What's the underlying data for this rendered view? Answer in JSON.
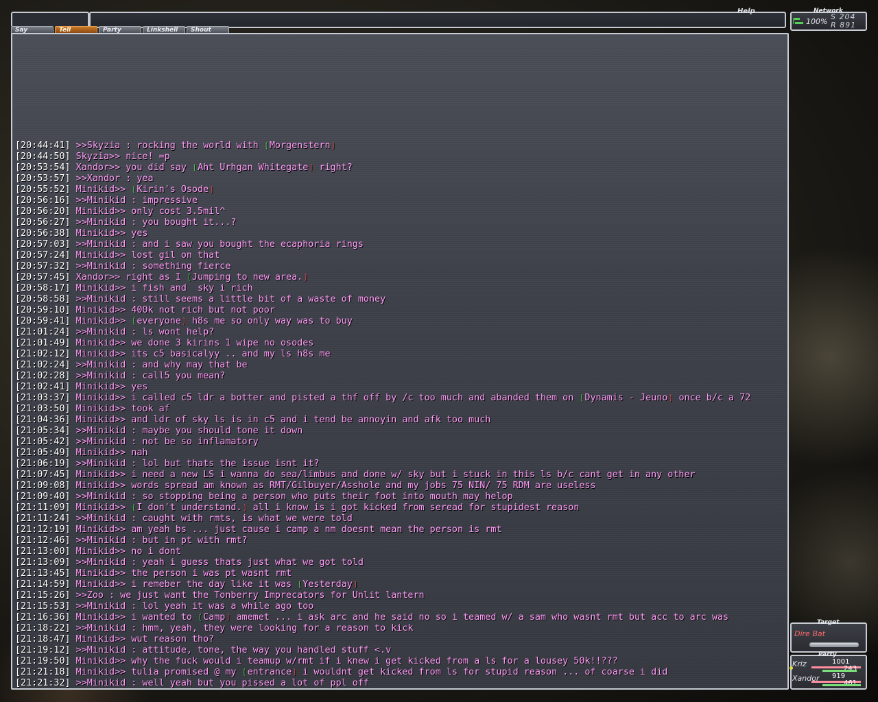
{
  "header": {
    "help_label": "Help",
    "tabs": [
      {
        "label": "Say"
      },
      {
        "label": "Tell"
      },
      {
        "label": "Party"
      },
      {
        "label": "Linkshell"
      },
      {
        "label": "Shout"
      }
    ],
    "active_tab": "Tell"
  },
  "network": {
    "label": "Network",
    "percent": "100%",
    "s_value": "S 204",
    "r_value": "R 891"
  },
  "target": {
    "label": "Target",
    "name": "Dire Bat",
    "hp_fraction": 1.0
  },
  "party": {
    "label": "Party",
    "members": [
      {
        "name": "Kriz",
        "hp": "1001",
        "mp": "243",
        "hp_fraction": 1.0,
        "mp_fraction": 0.9
      },
      {
        "name": "Xandor",
        "hp": "919",
        "mp": "461",
        "hp_fraction": 1.0,
        "mp_fraction": 1.0
      }
    ]
  },
  "colors": {
    "chat_text": "#ff9cf7",
    "autotranslate_open": "#4ee04a",
    "autotranslate_close": "#ff4b4b",
    "active_tab": "#c97a28"
  },
  "chat": [
    {
      "ts": "[20:44:41]",
      "pre": " >>Skyzia : rocking the world with ",
      "at": "Morgenstern",
      "post": ""
    },
    {
      "ts": "[20:44:50]",
      "pre": " Skyzia>> nice! =p",
      "at": "",
      "post": ""
    },
    {
      "ts": "[20:53:54]",
      "pre": " Xandor>> you did say ",
      "at": "Aht Urhgan Whitegate",
      "post": " right?"
    },
    {
      "ts": "[20:53:57]",
      "pre": " >>Xandor : yea",
      "at": "",
      "post": ""
    },
    {
      "ts": "[20:55:52]",
      "pre": " Minikid>> ",
      "at": "Kirin's Osode",
      "post": ""
    },
    {
      "ts": "[20:56:16]",
      "pre": " >>Minikid : impressive",
      "at": "",
      "post": ""
    },
    {
      "ts": "[20:56:20]",
      "pre": " Minikid>> only cost 3.5mil^",
      "at": "",
      "post": ""
    },
    {
      "ts": "[20:56:27]",
      "pre": " >>Minikid : you bought it...?",
      "at": "",
      "post": ""
    },
    {
      "ts": "[20:56:38]",
      "pre": " Minikid>> yes",
      "at": "",
      "post": ""
    },
    {
      "ts": "[20:57:03]",
      "pre": " >>Minikid : and i saw you bought the ecaphoria rings",
      "at": "",
      "post": ""
    },
    {
      "ts": "[20:57:24]",
      "pre": " Minikid>> lost gil on that",
      "at": "",
      "post": ""
    },
    {
      "ts": "[20:57:32]",
      "pre": " >>Minikid : something fierce",
      "at": "",
      "post": ""
    },
    {
      "ts": "[20:57:45]",
      "pre": " Xandor>> right as I ",
      "at": "Jumping to new area.",
      "post": ""
    },
    {
      "ts": "[20:58:17]",
      "pre": " Minikid>> i fish and  sky i rich",
      "at": "",
      "post": ""
    },
    {
      "ts": "[20:58:58]",
      "pre": " >>Minikid : still seems a little bit of a waste of money",
      "at": "",
      "post": ""
    },
    {
      "ts": "[20:59:10]",
      "pre": " Minikid>> 400k not rich but not poor",
      "at": "",
      "post": ""
    },
    {
      "ts": "[20:59:41]",
      "pre": " Minikid>> ",
      "at": "everyone",
      "post": " h8s me so only way was to buy"
    },
    {
      "ts": "[21:01:24]",
      "pre": " >>Minikid : ls wont help?",
      "at": "",
      "post": ""
    },
    {
      "ts": "[21:01:49]",
      "pre": " Minikid>> we done 3 kirins 1 wipe no osodes",
      "at": "",
      "post": ""
    },
    {
      "ts": "[21:02:12]",
      "pre": " Minikid>> its c5 basicalyy .. and my ls h8s me",
      "at": "",
      "post": ""
    },
    {
      "ts": "[21:02:24]",
      "pre": " >>Minikid : and why may that be",
      "at": "",
      "post": ""
    },
    {
      "ts": "[21:02:28]",
      "pre": " >>Minikid : call5 you mean?",
      "at": "",
      "post": ""
    },
    {
      "ts": "[21:02:41]",
      "pre": " Minikid>> yes",
      "at": "",
      "post": ""
    },
    {
      "ts": "[21:03:37]",
      "pre": " Minikid>> i called c5 ldr a botter and pisted a thf off by /c too much and abanded them on ",
      "at": "Dynamis - Jeuno",
      "post": " once b/c a 72"
    },
    {
      "ts": "[21:03:50]",
      "pre": " Minikid>> took af",
      "at": "",
      "post": ""
    },
    {
      "ts": "[21:04:36]",
      "pre": " Minikid>> and ldr of sky ls is in c5 and i tend be annoyin and afk too much",
      "at": "",
      "post": ""
    },
    {
      "ts": "[21:05:34]",
      "pre": " >>Minikid : maybe you should tone it down",
      "at": "",
      "post": ""
    },
    {
      "ts": "[21:05:42]",
      "pre": " >>Minikid : not be so inflamatory",
      "at": "",
      "post": ""
    },
    {
      "ts": "[21:05:49]",
      "pre": " Minikid>> nah",
      "at": "",
      "post": ""
    },
    {
      "ts": "[21:06:19]",
      "pre": " >>Minikid : lol but thats the issue isnt it?",
      "at": "",
      "post": ""
    },
    {
      "ts": "[21:07:45]",
      "pre": " Minikid>> i need a new LS i wanna do sea/limbus and done w/ sky but i stuck in this ls b/c cant get in any other",
      "at": "",
      "post": ""
    },
    {
      "ts": "[21:09:08]",
      "pre": " Minikid>> words spread am known as RMT/Gilbuyer/Asshole and my jobs 75 NIN/ 75 RDM are useless",
      "at": "",
      "post": ""
    },
    {
      "ts": "[21:09:40]",
      "pre": " >>Minikid : so stopping being a person who puts their foot into mouth may helop",
      "at": "",
      "post": ""
    },
    {
      "ts": "[21:11:09]",
      "pre": " Minikid>> ",
      "at": "I don't understand.",
      "post": " all i know is i got kicked from seread for stupidest reason"
    },
    {
      "ts": "[21:11:24]",
      "pre": " >>Minikid : caught with rmts, is what we were told",
      "at": "",
      "post": ""
    },
    {
      "ts": "[21:12:19]",
      "pre": " Minikid>> am yeah bs ... just cause i camp a nm doesnt mean the person is rmt",
      "at": "",
      "post": ""
    },
    {
      "ts": "[21:12:46]",
      "pre": " >>Minikid : but in pt with rmt?",
      "at": "",
      "post": ""
    },
    {
      "ts": "[21:13:00]",
      "pre": " Minikid>> no i dont",
      "at": "",
      "post": ""
    },
    {
      "ts": "[21:13:09]",
      "pre": " >>Minikid : yeah i guess thats just what we got told",
      "at": "",
      "post": ""
    },
    {
      "ts": "[21:13:45]",
      "pre": " Minikid>> the person i was pt wasnt rmt",
      "at": "",
      "post": ""
    },
    {
      "ts": "[21:14:59]",
      "pre": " Minikid>> i remeber the day like it was ",
      "at": "Yesterday",
      "post": ""
    },
    {
      "ts": "[21:15:26]",
      "pre": " >>Zoo : we just want the Tonberry Imprecators for Unlit lantern",
      "at": "",
      "post": ""
    },
    {
      "ts": "[21:15:53]",
      "pre": " >>Minikid : lol yeah it was a while ago too",
      "at": "",
      "post": ""
    },
    {
      "ts": "[21:16:36]",
      "pre": " Minikid>> i wanted to ",
      "at": "Camp",
      "post": " amemet ... i ask arc and he said no so i teamed w/ a sam who wasnt rmt but acc to arc was"
    },
    {
      "ts": "[21:18:22]",
      "pre": " >>Minikid : hmm, yeah, they were looking for a reason to kick",
      "at": "",
      "post": ""
    },
    {
      "ts": "[21:18:47]",
      "pre": " Minikid>> wut reason tho?",
      "at": "",
      "post": ""
    },
    {
      "ts": "[21:19:12]",
      "pre": " >>Minikid : attitude, tone, the way you handled stuff <.v",
      "at": "",
      "post": ""
    },
    {
      "ts": "[21:19:50]",
      "pre": " Minikid>> why the fuck would i teamup w/rmt if i knew i get kicked from a ls for a lousey 50k!!???",
      "at": "",
      "post": ""
    },
    {
      "ts": "[21:21:18]",
      "pre": " Minikid>> tulia promised @ my ",
      "at": "entrance",
      "post": " i wouldnt get kicked from ls for stupid reason ... of coarse i did"
    },
    {
      "ts": "[21:21:32]",
      "pre": " >>Minikid : well yeah but you pissed a lot of ppl off",
      "at": "",
      "post": ""
    }
  ]
}
